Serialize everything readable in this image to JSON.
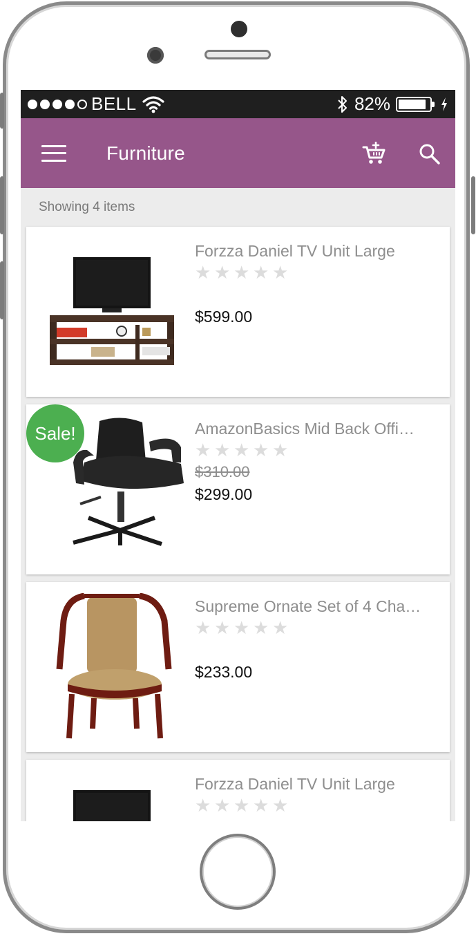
{
  "status": {
    "carrier": "BELL",
    "battery": "82%"
  },
  "appbar": {
    "title": "Furniture"
  },
  "listing": {
    "count_label": "Showing 4 items"
  },
  "products": [
    {
      "name": "Forzza Daniel TV Unit Large",
      "price": "$599.00",
      "old_price": "",
      "sale": "",
      "rating": 0
    },
    {
      "name": "AmazonBasics Mid Back Offi…",
      "price": "$299.00",
      "old_price": "$310.00",
      "sale": "Sale!",
      "rating": 0
    },
    {
      "name": "Supreme Ornate Set of 4 Cha…",
      "price": "$233.00",
      "old_price": "",
      "sale": "",
      "rating": 0
    },
    {
      "name": "Forzza Daniel TV Unit Large",
      "price": "",
      "old_price": "",
      "sale": "",
      "rating": 0
    }
  ],
  "colors": {
    "accent": "#96568a",
    "sale_badge": "#4caf50"
  }
}
